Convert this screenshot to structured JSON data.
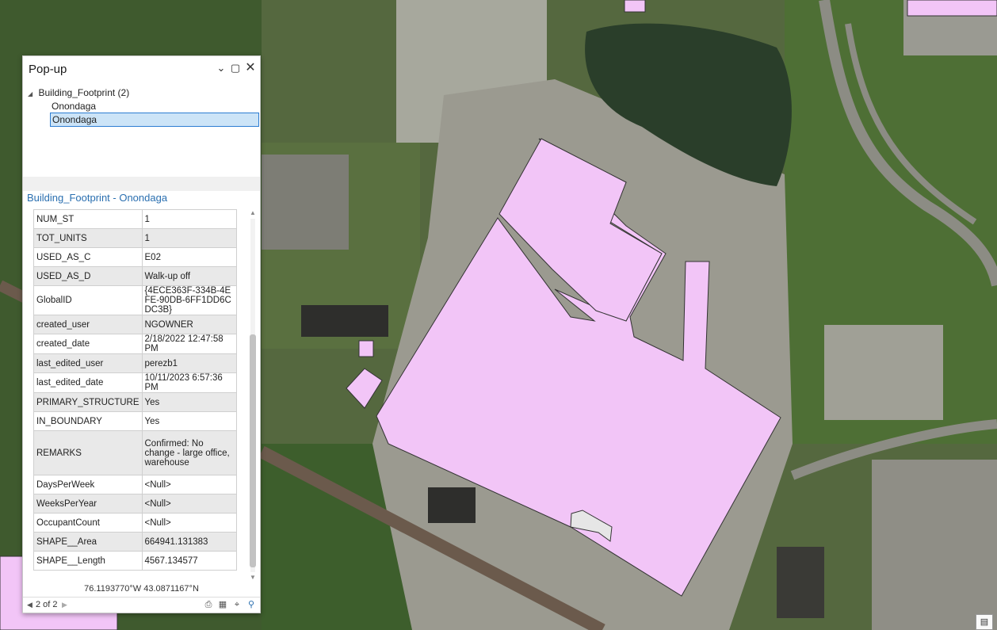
{
  "popup": {
    "title": "Pop-up",
    "minimize_icon": "chevron-down-icon",
    "maximize_icon": "maximize-icon",
    "close_icon": "close-icon",
    "tree": {
      "group_label": "Building_Footprint (2)",
      "items": [
        "Onondaga",
        "Onondaga"
      ],
      "selected_index": 1
    },
    "feature_title": "Building_Footprint - Onondaga",
    "attributes": [
      {
        "key": "NUM_ST",
        "value": "1"
      },
      {
        "key": "TOT_UNITS",
        "value": "1"
      },
      {
        "key": "USED_AS_C",
        "value": "E02"
      },
      {
        "key": "USED_AS_D",
        "value": "Walk-up off"
      },
      {
        "key": "GlobalID",
        "value": "{4ECE363F-334B-4EFE-90DB-6FF1DD6CDC3B}"
      },
      {
        "key": "created_user",
        "value": "NGOWNER"
      },
      {
        "key": "created_date",
        "value": "2/18/2022 12:47:58 PM"
      },
      {
        "key": "last_edited_user",
        "value": "perezb1"
      },
      {
        "key": "last_edited_date",
        "value": "10/11/2023 6:57:36 PM"
      },
      {
        "key": "PRIMARY_STRUCTURE",
        "value": "Yes"
      },
      {
        "key": "IN_BOUNDARY",
        "value": "Yes"
      },
      {
        "key": "REMARKS",
        "value": "Confirmed: No change - large office, warehouse"
      },
      {
        "key": "DaysPerWeek",
        "value": "<Null>"
      },
      {
        "key": "WeeksPerYear",
        "value": "<Null>"
      },
      {
        "key": "OccupantCount",
        "value": "<Null>"
      },
      {
        "key": "SHAPE__Area",
        "value": "664941.131383"
      },
      {
        "key": "SHAPE__Length",
        "value": "4567.134577"
      }
    ],
    "coordinates": "76.1193770°W 43.0871167°N",
    "nav": {
      "text": "2 of 2",
      "prev_icon": "triangle-left-icon",
      "next_icon": "triangle-right-icon"
    },
    "footer_icons": [
      "print-icon",
      "export-icon",
      "pan-to-icon",
      "zoom-to-icon"
    ]
  },
  "map": {
    "footprint_color": "#f2c5f7",
    "footprint_outline": "#333333",
    "corner_button_icon": "table-icon"
  }
}
